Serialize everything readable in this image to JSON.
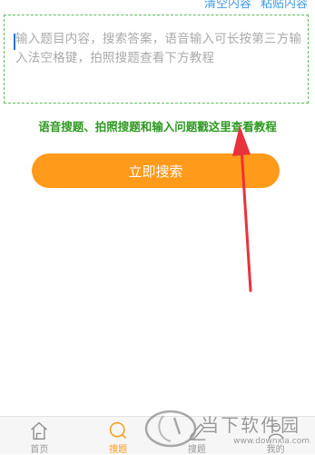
{
  "top_actions": {
    "clear_label": "清空内容",
    "paste_label": "粘贴内容"
  },
  "question_input": {
    "placeholder": "输入题目内容，搜索答案，语音输入可长按第三方输入法空格键，拍照搜题查看下方教程",
    "value": ""
  },
  "tutorial_link": "语音搜题、拍照搜题和输入问题戳这里查看教程",
  "search_button": "立即搜索",
  "tabbar": {
    "tabs": [
      {
        "label": "首页",
        "icon": "home-icon",
        "active": false
      },
      {
        "label": "搜题",
        "icon": "search-icon",
        "active": true
      },
      {
        "label": "搜题",
        "icon": "pen-icon",
        "active": false
      },
      {
        "label": "我的",
        "icon": "user-icon",
        "active": false
      }
    ]
  },
  "watermark": {
    "brand": "当下软件园",
    "url": "www.downxia.com"
  },
  "colors": {
    "accent": "#ff9a1a",
    "link_blue": "#3d9ae8",
    "tutorial_green": "#2c9a1f",
    "arrow_red": "#e8323c"
  }
}
